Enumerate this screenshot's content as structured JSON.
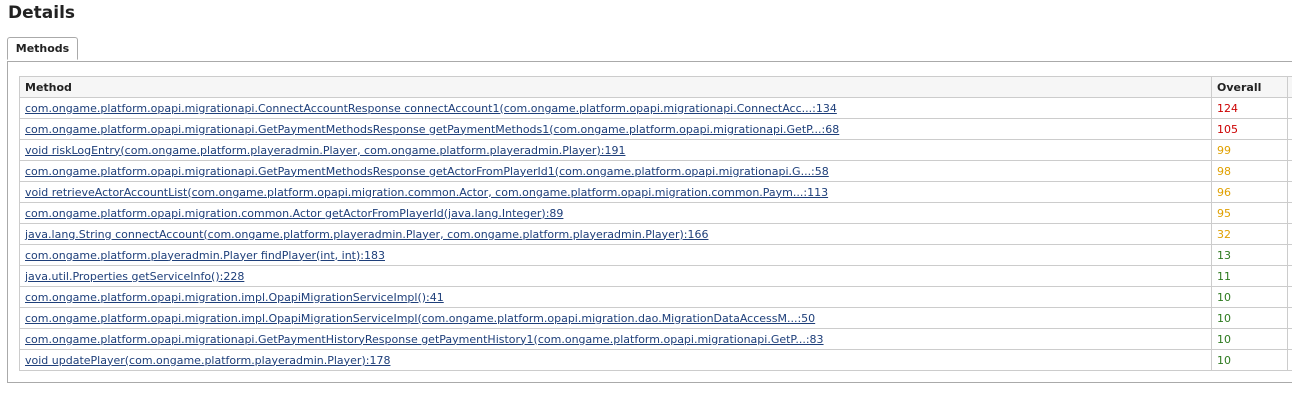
{
  "page": {
    "title": "Details"
  },
  "tabs": [
    {
      "label": "Methods"
    }
  ],
  "table": {
    "columns": {
      "method": "Method",
      "overall": "Overall"
    },
    "rows": [
      {
        "method": "com.ongame.platform.opapi.migrationapi.ConnectAccountResponse connectAccount1(com.ongame.platform.opapi.migrationapi.ConnectAcc...:134",
        "overall": "124",
        "level": "red"
      },
      {
        "method": "com.ongame.platform.opapi.migrationapi.GetPaymentMethodsResponse getPaymentMethods1(com.ongame.platform.opapi.migrationapi.GetP...:68",
        "overall": "105",
        "level": "red"
      },
      {
        "method": "void riskLogEntry(com.ongame.platform.playeradmin.Player, com.ongame.platform.playeradmin.Player):191",
        "overall": "99",
        "level": "orange"
      },
      {
        "method": "com.ongame.platform.opapi.migrationapi.GetPaymentMethodsResponse getActorFromPlayerId1(com.ongame.platform.opapi.migrationapi.G...:58",
        "overall": "98",
        "level": "orange"
      },
      {
        "method": "void retrieveActorAccountList(com.ongame.platform.opapi.migration.common.Actor, com.ongame.platform.opapi.migration.common.Paym...:113",
        "overall": "96",
        "level": "orange"
      },
      {
        "method": "com.ongame.platform.opapi.migration.common.Actor getActorFromPlayerId(java.lang.Integer):89",
        "overall": "95",
        "level": "orange"
      },
      {
        "method": "java.lang.String connectAccount(com.ongame.platform.playeradmin.Player, com.ongame.platform.playeradmin.Player):166",
        "overall": "32",
        "level": "orange"
      },
      {
        "method": "com.ongame.platform.playeradmin.Player findPlayer(int, int):183",
        "overall": "13",
        "level": "green"
      },
      {
        "method": "java.util.Properties getServiceInfo():228",
        "overall": "11",
        "level": "green"
      },
      {
        "method": "com.ongame.platform.opapi.migration.impl.OpapiMigrationServiceImpl():41",
        "overall": "10",
        "level": "green"
      },
      {
        "method": "com.ongame.platform.opapi.migration.impl.OpapiMigrationServiceImpl(com.ongame.platform.opapi.migration.dao.MigrationDataAccessM...:50",
        "overall": "10",
        "level": "green"
      },
      {
        "method": "com.ongame.platform.opapi.migrationapi.GetPaymentHistoryResponse getPaymentHistory1(com.ongame.platform.opapi.migrationapi.GetP...:83",
        "overall": "10",
        "level": "green"
      },
      {
        "method": "void updatePlayer(com.ongame.platform.playeradmin.Player):178",
        "overall": "10",
        "level": "green"
      }
    ]
  },
  "colors": {
    "red": "#cc0000",
    "orange": "#e0a000",
    "green": "#2d7a1f",
    "link": "#1e3f7a"
  }
}
